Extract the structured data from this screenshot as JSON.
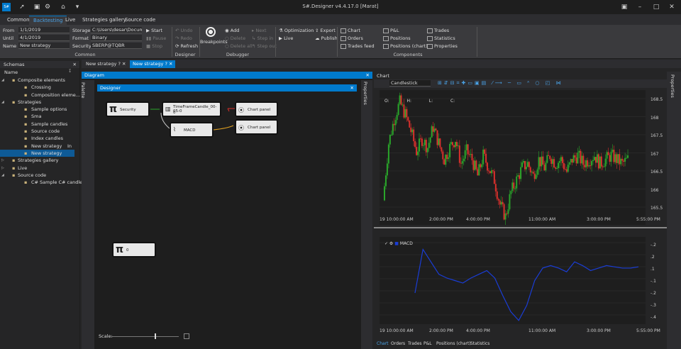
{
  "app": {
    "title": "S#.Designer v4.4.17.0 [Marat]",
    "logo": "S#"
  },
  "ribbon_tabs": [
    "Common",
    "Backtesting",
    "Live",
    "Strategies gallery",
    "Source code"
  ],
  "ribbon": {
    "from_label": "From",
    "from_value": "1/1/2019",
    "until_label": "Until",
    "until_value": "4/1/2019",
    "name_label": "Name",
    "name_value": "New strategy",
    "storage_label": "Storage",
    "storage_value": "C:\\Users\\desar\\Documer",
    "format_label": "Format",
    "format_value": "Binary",
    "security_label": "Security",
    "security_value": "SBERP@TQBR",
    "start": "Start",
    "pause": "Pause",
    "stop": "Stop",
    "common_group": "Common",
    "undo": "Undo",
    "redo": "Redo",
    "refresh": "Refresh",
    "designer_group": "Designer",
    "breakpoints": "Breakpoints",
    "add": "Add",
    "delete": "Delete",
    "delete_all": "Delete all",
    "next": "Next",
    "step_in": "Step in",
    "step_out": "Step out",
    "debugger_group": "Debugger",
    "optimization": "Optimization",
    "live": "Live",
    "export": "Export",
    "publish": "Publish",
    "chart": "Chart",
    "orders": "Orders",
    "trades_feed": "Trades feed",
    "pnl": "P&L",
    "positions": "Positions",
    "positions_chart": "Positions (chart)",
    "trades": "Trades",
    "statistics": "Statistics",
    "properties": "Properties",
    "components_group": "Components"
  },
  "doc_tabs": [
    "New strategy",
    "New strategy"
  ],
  "schemas": {
    "title": "Schemas",
    "col_name": "Name",
    "items": [
      {
        "label": "Composite elements",
        "lvl": 0,
        "exp": true
      },
      {
        "label": "Crossing",
        "lvl": 1
      },
      {
        "label": "Composition eleme...",
        "lvl": 1
      },
      {
        "label": "Strategies",
        "lvl": 0,
        "exp": true
      },
      {
        "label": "Sample options",
        "lvl": 1
      },
      {
        "label": "Sma",
        "lvl": 1
      },
      {
        "label": "Sample candles",
        "lvl": 1
      },
      {
        "label": "Source code",
        "lvl": 1
      },
      {
        "label": "Index candles",
        "lvl": 1
      },
      {
        "label": "New strategy",
        "lvl": 1,
        "extra": "In"
      },
      {
        "label": "New strategy",
        "lvl": 1,
        "sel": true
      },
      {
        "label": "Strategies gallery",
        "lvl": 0,
        "exp": false
      },
      {
        "label": "Live",
        "lvl": 0,
        "exp": false
      },
      {
        "label": "Source code",
        "lvl": 0,
        "exp": true
      },
      {
        "label": "C# Sample C# candles",
        "lvl": 1
      }
    ]
  },
  "diagram": {
    "title": "Diagram",
    "palette": "Palette",
    "designer": "Designer",
    "properties": "Properties",
    "scale": "Scale:",
    "nodes": {
      "security": "Security",
      "candle": "TimeFrameCandle_00-05-0",
      "candle_sub": "0",
      "macd": "MACD",
      "chart_panel": "Chart panel",
      "chart_panel2": "Chart panel",
      "pi_value": "0"
    }
  },
  "chart": {
    "title": "Chart",
    "style": "Candlestick",
    "ohlc": {
      "o": "O:",
      "h": "H:",
      "l": "L:",
      "c": "C:"
    },
    "y_ticks": [
      "168.5",
      "168",
      "167.5",
      "167",
      "166.5",
      "166",
      "165.5"
    ],
    "x_ticks": [
      "19 10:00:00 AM",
      "2:00:00 PM",
      "4:00:00 PM",
      "11:00:00 AM",
      "3:00:00 PM",
      "5:55:00 PM"
    ],
    "macd_label": "MACD",
    "macd_y_ticks": [
      "-.2",
      ".2",
      ".1",
      "-.1",
      "-.2",
      "-.3",
      "-.4"
    ],
    "bottom_tabs": [
      "Chart",
      "Orders",
      "Trades",
      "P&L",
      "Positions (chart)",
      "Statistics"
    ],
    "colors": {
      "up": "#2aa52a",
      "down": "#d9302c",
      "macd": "#1a3dd6",
      "bg": "#1e1e1e"
    }
  },
  "chart_data": [
    {
      "type": "candlestick",
      "title": "",
      "ylim": [
        165.4,
        168.7
      ],
      "x": [
        "19 10:00:00 AM",
        "2:00:00 PM",
        "4:00:00 PM",
        "11:00:00 AM",
        "3:00:00 PM",
        "5:55:00 PM"
      ],
      "close": [
        166.0,
        167.4,
        168.0,
        168.4,
        168.1,
        167.7,
        167.2,
        167.5,
        167.3,
        167.8,
        167.4,
        167.0,
        167.3,
        167.5,
        166.9,
        167.2,
        167.0,
        166.6,
        167.1,
        166.8,
        166.5,
        165.9,
        165.6,
        166.2,
        166.5,
        166.8,
        166.9,
        166.6,
        167.0,
        166.8,
        167.1,
        166.9,
        167.0,
        166.7,
        167.0,
        167.1,
        166.9,
        167.0,
        167.1,
        166.9,
        167.0,
        167.1,
        167.0,
        166.9,
        167.0
      ]
    },
    {
      "type": "line",
      "title": "MACD",
      "ylim": [
        -0.45,
        0.25
      ],
      "values": [
        -0.2,
        0.15,
        0.05,
        -0.05,
        -0.08,
        -0.1,
        -0.12,
        -0.08,
        -0.05,
        -0.02,
        -0.08,
        -0.22,
        -0.35,
        -0.42,
        -0.3,
        -0.1,
        0.0,
        0.02,
        0.0,
        -0.03,
        0.05,
        0.02,
        -0.02,
        0.0,
        0.02,
        0.01,
        0.0,
        0.0,
        0.01
      ]
    }
  ]
}
